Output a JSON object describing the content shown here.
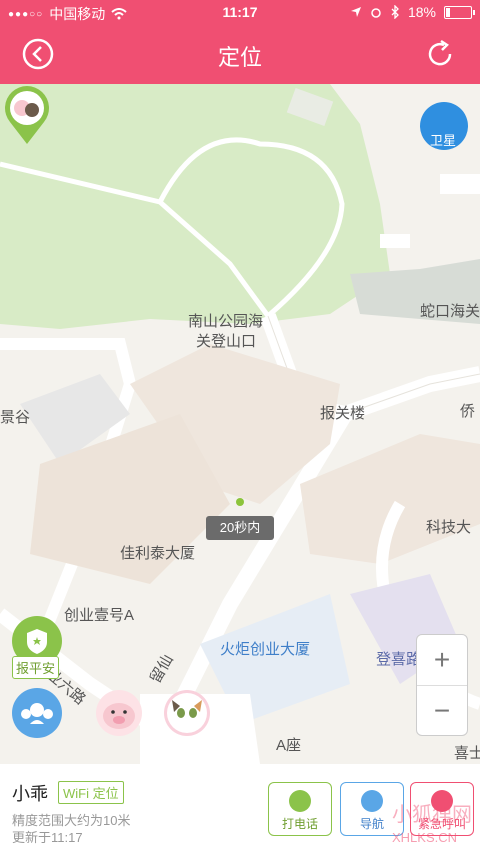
{
  "status_bar": {
    "carrier": "中国移动",
    "time": "11:17",
    "battery": "18%"
  },
  "nav": {
    "title": "定位"
  },
  "map": {
    "satellite_label": "卫星",
    "labels": [
      "南山公园海",
      "关登山口",
      "报关楼",
      "蛇口海关",
      "侨",
      "科技大",
      "佳利泰大厦",
      "创业壹号A",
      "火炬创业大厦",
      "登喜路",
      "A座",
      "喜士",
      "业六路",
      "留仙",
      "景谷"
    ],
    "time_tip": "20秒内",
    "safe_label": "报平安"
  },
  "panel": {
    "name": "小乖",
    "badge": "WiFi 定位",
    "accuracy": "精度范围大约为10米",
    "updated": "更新于11:17",
    "call_label": "打电话",
    "nav_label": "导航",
    "sos_label": "紧急呼叫"
  },
  "watermark": {
    "title": "小狐狸网",
    "url": "XHLKS.CN"
  },
  "colors": {
    "brand": "#f04f72",
    "green": "#8bc34a",
    "blue": "#5aa6e6"
  }
}
